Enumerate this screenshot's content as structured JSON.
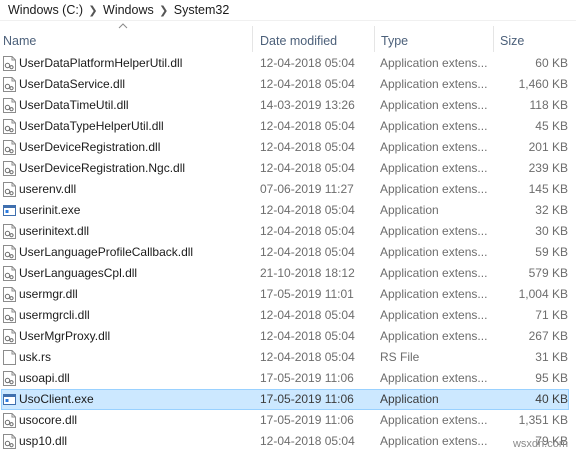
{
  "breadcrumb": {
    "items": [
      "Windows (C:)",
      "Windows",
      "System32"
    ]
  },
  "columns": {
    "name": "Name",
    "date": "Date modified",
    "type": "Type",
    "size": "Size"
  },
  "files": [
    {
      "name": "UserDataPlatformHelperUtil.dll",
      "date": "12-04-2018 05:04",
      "type": "Application extens...",
      "size": "60 KB",
      "icon": "dll-file-icon"
    },
    {
      "name": "UserDataService.dll",
      "date": "12-04-2018 05:04",
      "type": "Application extens...",
      "size": "1,460 KB",
      "icon": "dll-file-icon"
    },
    {
      "name": "UserDataTimeUtil.dll",
      "date": "14-03-2019 13:26",
      "type": "Application extens...",
      "size": "118 KB",
      "icon": "dll-file-icon"
    },
    {
      "name": "UserDataTypeHelperUtil.dll",
      "date": "12-04-2018 05:04",
      "type": "Application extens...",
      "size": "45 KB",
      "icon": "dll-file-icon"
    },
    {
      "name": "UserDeviceRegistration.dll",
      "date": "12-04-2018 05:04",
      "type": "Application extens...",
      "size": "201 KB",
      "icon": "dll-file-icon"
    },
    {
      "name": "UserDeviceRegistration.Ngc.dll",
      "date": "12-04-2018 05:04",
      "type": "Application extens...",
      "size": "239 KB",
      "icon": "dll-file-icon"
    },
    {
      "name": "userenv.dll",
      "date": "07-06-2019 11:27",
      "type": "Application extens...",
      "size": "145 KB",
      "icon": "dll-file-icon"
    },
    {
      "name": "userinit.exe",
      "date": "12-04-2018 05:04",
      "type": "Application",
      "size": "32 KB",
      "icon": "exe-file-icon"
    },
    {
      "name": "userinitext.dll",
      "date": "12-04-2018 05:04",
      "type": "Application extens...",
      "size": "30 KB",
      "icon": "dll-file-icon"
    },
    {
      "name": "UserLanguageProfileCallback.dll",
      "date": "12-04-2018 05:04",
      "type": "Application extens...",
      "size": "59 KB",
      "icon": "dll-file-icon"
    },
    {
      "name": "UserLanguagesCpl.dll",
      "date": "21-10-2018 18:12",
      "type": "Application extens...",
      "size": "579 KB",
      "icon": "dll-file-icon"
    },
    {
      "name": "usermgr.dll",
      "date": "17-05-2019 11:01",
      "type": "Application extens...",
      "size": "1,004 KB",
      "icon": "dll-file-icon"
    },
    {
      "name": "usermgrcli.dll",
      "date": "12-04-2018 05:04",
      "type": "Application extens...",
      "size": "71 KB",
      "icon": "dll-file-icon"
    },
    {
      "name": "UserMgrProxy.dll",
      "date": "12-04-2018 05:04",
      "type": "Application extens...",
      "size": "267 KB",
      "icon": "dll-file-icon"
    },
    {
      "name": "usk.rs",
      "date": "12-04-2018 05:04",
      "type": "RS File",
      "size": "31 KB",
      "icon": "blank-file-icon"
    },
    {
      "name": "usoapi.dll",
      "date": "17-05-2019 11:06",
      "type": "Application extens...",
      "size": "95 KB",
      "icon": "dll-file-icon"
    },
    {
      "name": "UsoClient.exe",
      "date": "17-05-2019 11:06",
      "type": "Application",
      "size": "40 KB",
      "icon": "exe-file-icon",
      "selected": true
    },
    {
      "name": "usocore.dll",
      "date": "17-05-2019 11:06",
      "type": "Application extens...",
      "size": "1,351 KB",
      "icon": "dll-file-icon"
    },
    {
      "name": "usp10.dll",
      "date": "12-04-2018 05:04",
      "type": "Application extens...",
      "size": "79 KB",
      "icon": "dll-file-icon"
    }
  ],
  "watermark": "wsxdn.com"
}
